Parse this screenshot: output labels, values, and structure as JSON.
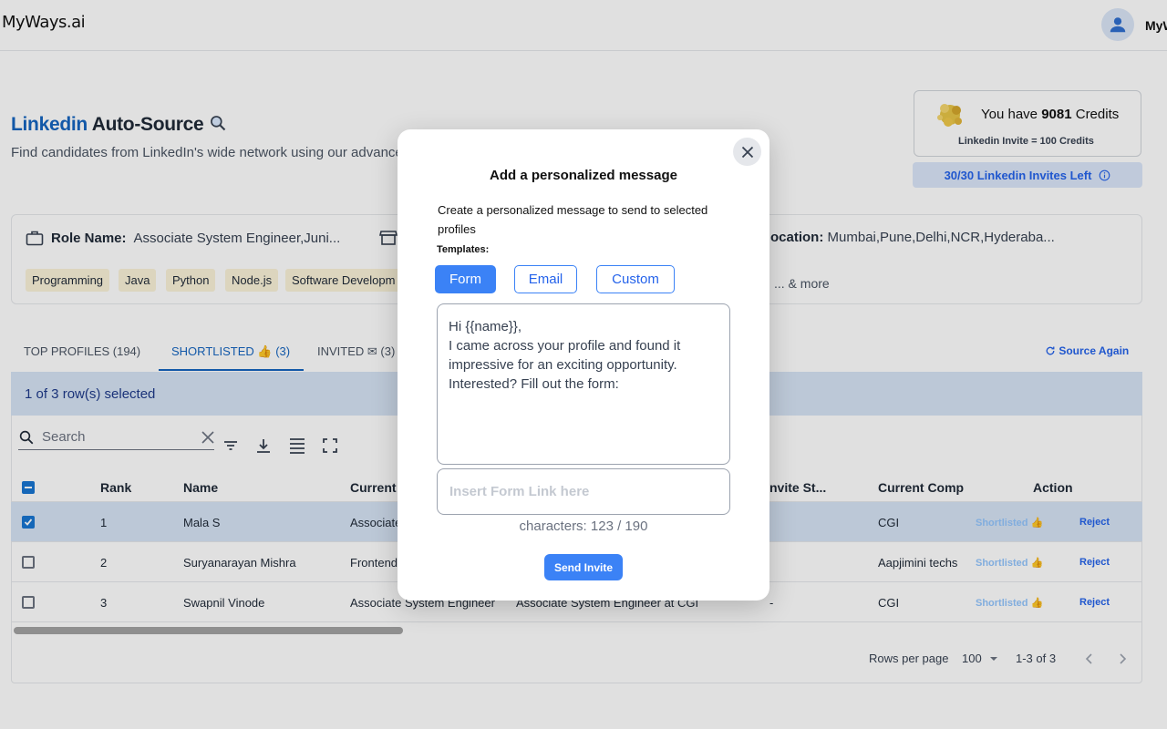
{
  "header": {
    "logo": "MyWays.ai",
    "username": "MyWays"
  },
  "page": {
    "title_blue": "Linkedin",
    "title_black": "Auto-Source",
    "subtitle": "Find candidates from LinkedIn's wide network using our advanced"
  },
  "credits": {
    "prefix": "You have",
    "amount": "9081",
    "suffix": "Credits",
    "rate": "Linkedin Invite = 100 Credits",
    "invites_left": "30/30 Linkedin Invites Left"
  },
  "role": {
    "label": "Role Name:",
    "value": "Associate System Engineer,Juni...",
    "location_label": "ocation:",
    "location_value": "Mumbai,Pune,Delhi,NCR,Hyderaba...",
    "skills": [
      "Programming",
      "Java",
      "Python",
      "Node.js",
      "Software Developm"
    ],
    "more": "... & more"
  },
  "tabs": {
    "top_profiles": "TOP PROFILES (194)",
    "shortlisted": "SHORTLISTED 👍 (3)",
    "invited": "INVITED ✉ (3)",
    "source_again": "Source Again"
  },
  "table": {
    "selection": "1 of 3 row(s) selected",
    "search_placeholder": "Search",
    "columns": {
      "rank": "Rank",
      "name": "Name",
      "current": "Current",
      "invite_status": "nvite St...",
      "current_company": "Current Comp",
      "action": "Action"
    },
    "rows": [
      {
        "rank": "1",
        "name": "Mala S",
        "current": "Associate",
        "headline": "",
        "invite": "",
        "company": "CGI",
        "shortlisted": "Shortlisted 👍",
        "reject": "Reject",
        "checked": true
      },
      {
        "rank": "2",
        "name": "Suryanarayan Mishra",
        "current": "Frontend",
        "headline": "",
        "invite": "",
        "company": "Aapjimini techs",
        "shortlisted": "Shortlisted 👍",
        "reject": "Reject",
        "checked": false
      },
      {
        "rank": "3",
        "name": "Swapnil Vinode",
        "current": "Associate System Engineer",
        "headline": "Associate System Engineer at CGI",
        "invite": "-",
        "company": "CGI",
        "shortlisted": "Shortlisted 👍",
        "reject": "Reject",
        "checked": false
      }
    ],
    "rows_per_page_label": "Rows per page",
    "rows_per_page_value": "100",
    "range": "1-3 of 3"
  },
  "modal": {
    "title": "Add a personalized message",
    "description": "Create a personalized message to send to selected profiles",
    "templates_label": "Templates:",
    "templates": [
      "Form",
      "Email",
      "Custom"
    ],
    "selected_template": "Form",
    "message": "Hi {{name}},\nI came across your profile and found it impressive for an exciting opportunity. Interested? Fill out the form:",
    "link_placeholder": "Insert Form Link here",
    "char_count": "characters: 123 / 190",
    "send_label": "Send Invite"
  },
  "colors": {
    "brand_blue": "#1565c0",
    "button_blue": "#3b82f6",
    "chip_bg": "#fbf3d9",
    "selection_bg": "#d6e4f5"
  },
  "icons": [
    "user-icon",
    "coins-icon",
    "info-icon",
    "briefcase-icon",
    "store-icon",
    "refresh-icon",
    "search-icon",
    "clear-icon",
    "filter-icon",
    "download-icon",
    "density-icon",
    "fullscreen-icon",
    "close-icon",
    "checkbox-icon",
    "chevron-left-icon",
    "chevron-right-icon"
  ]
}
